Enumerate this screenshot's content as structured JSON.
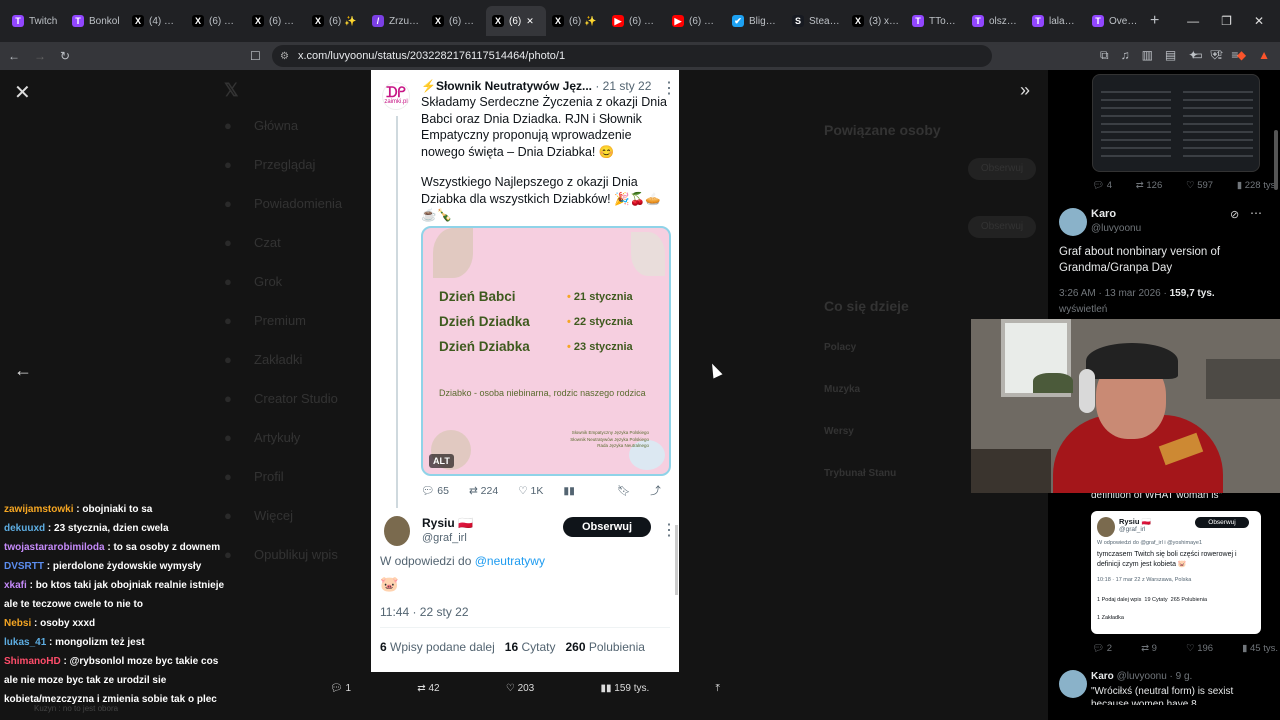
{
  "tabs": [
    {
      "label": "Twitch",
      "color": "#9146ff",
      "glyph": "T"
    },
    {
      "label": "Bonkol",
      "color": "#9146ff",
      "glyph": "T"
    },
    {
      "label": "(4) DOS",
      "color": "#000000",
      "glyph": "X"
    },
    {
      "label": "(6) QSN",
      "color": "#000000",
      "glyph": "X"
    },
    {
      "label": "(6) Oliv",
      "color": "#000000",
      "glyph": "X"
    },
    {
      "label": "(6) ✨",
      "color": "#000000",
      "glyph": "X"
    },
    {
      "label": "Zrzut e",
      "color": "#7b3fe4",
      "glyph": "/"
    },
    {
      "label": "(6) QSN",
      "color": "#000000",
      "glyph": "X"
    },
    {
      "label": "(6)",
      "color": "#000000",
      "glyph": "X",
      "active": true
    },
    {
      "label": "(6) ✨",
      "color": "#000000",
      "glyph": "X"
    },
    {
      "label": "(6) Futu",
      "color": "#ff0000",
      "glyph": "▶"
    },
    {
      "label": "(6) Bligh",
      "color": "#ff0000",
      "glyph": "▶"
    },
    {
      "label": "Blight: S",
      "color": "#1da1f2",
      "glyph": "✔"
    },
    {
      "label": "SteamD",
      "color": "#171a21",
      "glyph": "S"
    },
    {
      "label": "(3) xwe",
      "color": "#000000",
      "glyph": "X"
    },
    {
      "label": "TTobias",
      "color": "#9146ff",
      "glyph": "T"
    },
    {
      "label": "olszakc",
      "color": "#9146ff",
      "glyph": "T"
    },
    {
      "label": "lala_sty",
      "color": "#9146ff",
      "glyph": "T"
    },
    {
      "label": "Overpo",
      "color": "#9146ff",
      "glyph": "T"
    }
  ],
  "address": {
    "url": "x.com/luvyoonu/status/2032282176117514464/photo/1"
  },
  "ghost_nav": [
    "Główna",
    "Przeglądaj",
    "Powiadomienia",
    "Czat",
    "Grok",
    "Premium",
    "Zakładki",
    "Creator Studio",
    "Artykuły",
    "Profil",
    "Więcej",
    "Opublikuj wpis"
  ],
  "ghost_right": {
    "related": "Powiązane osoby",
    "follow": "Obserwuj",
    "happening": "Co się dzieje",
    "trends": [
      "Polacy",
      "Muzyka",
      "Wersy",
      "Trybunał Stanu"
    ]
  },
  "tweet": {
    "author": "Słownik Neutratywów Jęz...",
    "date": "· 21 sty 22",
    "avatar_text": "zaimki.pl",
    "text1": "Składamy Serdeczne Życzenia z okazji Dnia Babci oraz Dnia Dziadka. RJN i Słownik Empatyczny proponują wprowadzenie nowego święta – Dnia Dziabka! 😊",
    "text2": "Wszystkiego Najlepszego z okazji Dnia Dziabka dla wszystkich Dziabków! 🎉🍒🥧☕🍾",
    "image": {
      "rows": [
        {
          "day": "Dzień Babci",
          "date": "21 stycznia"
        },
        {
          "day": "Dzień Dziadka",
          "date": "22 stycznia"
        },
        {
          "day": "Dzień Dziabka",
          "date": "23 stycznia"
        }
      ],
      "definition": "Dziabko - osoba niebinarna, rodzic naszego rodzica",
      "credits": [
        "Słownik Empatyczny Języka Polskiego",
        "Słownik Neutratywów Języka Polskiego",
        "Rada Języka Neutralnego"
      ],
      "alt": "ALT"
    },
    "stats": {
      "replies": "65",
      "retweets": "224",
      "likes": "1K"
    }
  },
  "reply": {
    "name": "Rysiu 🇵🇱",
    "handle": "@graf_irl",
    "follow": "Obserwuj",
    "in_reply": "W odpowiedzi do",
    "mention": "@neutratywy",
    "body": "🐷",
    "time": "11:44 · 22 sty 22",
    "counts": [
      {
        "n": "6",
        "label": "Wpisy podane dalej"
      },
      {
        "n": "16",
        "label": "Cytaty"
      },
      {
        "n": "260",
        "label": "Polubienia"
      }
    ]
  },
  "bottom": {
    "replies": "1",
    "retweets": "42",
    "likes": "203",
    "views": "159 tys."
  },
  "chat": [
    {
      "user": "zawijamstowki",
      "color": "#f5a623",
      "msg": "obojniaki to sa"
    },
    {
      "user": "dekuuxd",
      "color": "#5dade2",
      "msg": "23 stycznia, dzien cwela"
    },
    {
      "user": "twojastararobimiloda",
      "color": "#c58af9",
      "msg": "to sa osoby z downem"
    },
    {
      "user": "DVSRTT",
      "color": "#5b8def",
      "msg": "pierdolone żydowskie wymysły"
    },
    {
      "user": "xkafi",
      "color": "#c58af9",
      "msg": "bo ktos taki jak obojniak realnie istnieje ale te teczowe cwele to nie to"
    },
    {
      "user": "Nebsi",
      "color": "#f5a623",
      "msg": "osoby xxxd"
    },
    {
      "user": "lukas_41",
      "color": "#5dade2",
      "msg": "mongolizm też jest"
    },
    {
      "user": "ShimanoHD",
      "color": "#ff4d6a",
      "msg": "@rybsonlol moze byc takie cos ale nie moze byc tak ze urodzil sie kobieta/mezczyzna i zmienia sobie tak o plec"
    }
  ],
  "chat_faded": "Kuzyn : no to jest obora",
  "side": {
    "top_stats": {
      "replies": "4",
      "retweets": "126",
      "likes": "597",
      "views": "228 tys."
    },
    "author": "Karo",
    "handle": "@luvyoonu",
    "text": "Graf about nonbinary version of Grandma/Granpa Day",
    "time": "3:26 AM · 13 mar 2026 ·",
    "views": "159,7 tys.",
    "views_label": "wyświetleń",
    "quote_line": "definition of WHAT woman is\"",
    "embed": {
      "name": "Rysiu 🇵🇱",
      "handle": "@graf_irl",
      "follow": "Obserwuj",
      "reply": "W odpowiedzi do @graf_irl i @yoshimaye1",
      "text": "tymczasem Twitch się boli części rowerowej i definicji czym jest kobieta 🐷",
      "time": "10:18 · 17 mar 22 z Warszawa, Polska",
      "counts": "1 Podaj dalej wpis  19 Cytaty  265 Polubienia",
      "bookmarks": "1 Zakładka"
    },
    "row2_stats": {
      "replies": "2",
      "retweets": "9",
      "likes": "196",
      "views": "45 tys."
    },
    "reply_author": "Karo",
    "reply_handle": "@luvyoonu · 9 g.",
    "reply_text": "\"Wróciłxś (neutral form) is sexist because women have 8"
  }
}
